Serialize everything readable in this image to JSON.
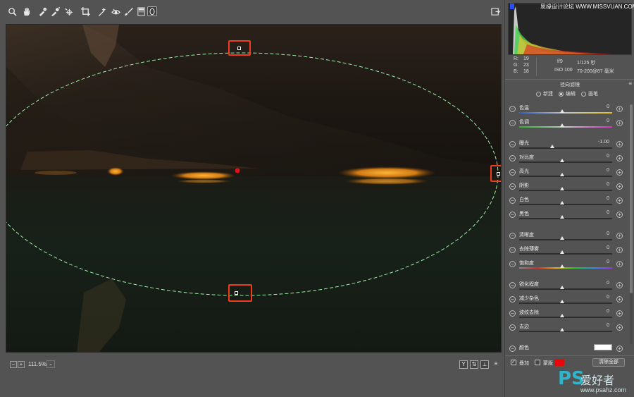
{
  "toolbar": {
    "tools": [
      "zoom-icon",
      "hand-icon",
      "white-balance-icon",
      "color-sampler-icon",
      "target-adjust-icon",
      "crop-icon",
      "spot-removal-icon",
      "red-eye-icon",
      "brush-icon",
      "graduated-filter-icon",
      "radial-filter-icon"
    ],
    "right_icon": "open-preferences-icon"
  },
  "canvas": {
    "zoom": "111.5%",
    "zoom_drop": "⌄",
    "zoom_out": "−",
    "zoom_in": "+",
    "view_buttons": [
      "Y",
      "⇅",
      "⟂",
      "≡"
    ]
  },
  "panel": {
    "watermark_top": "思缘设计论坛 WWW.MISSVUAN.COM",
    "rgb": {
      "r_label": "R:",
      "r": "19",
      "g_label": "G:",
      "g": "23",
      "b_label": "B:",
      "b": "18"
    },
    "camera": {
      "aperture": "f/9",
      "shutter": "1/125 秒",
      "iso": "ISO 100",
      "lens": "70-200@87 毫米"
    },
    "title": "径向滤镜",
    "menu": "≡",
    "modes": [
      {
        "label": "新建",
        "selected": false
      },
      {
        "label": "编辑",
        "selected": true
      },
      {
        "label": "画笔",
        "selected": false
      }
    ],
    "sliders": [
      {
        "label": "色温",
        "value": "0"
      },
      {
        "label": "色调",
        "value": "0"
      },
      {
        "label": "曝光",
        "value": "-1.00"
      },
      {
        "label": "对比度",
        "value": "0"
      },
      {
        "label": "高光",
        "value": "0"
      },
      {
        "label": "阴影",
        "value": "0"
      },
      {
        "label": "白色",
        "value": "0"
      },
      {
        "label": "黑色",
        "value": "0"
      },
      {
        "label": "清晰度",
        "value": "0"
      },
      {
        "label": "去除薄雾",
        "value": "0"
      },
      {
        "label": "饱和度",
        "value": "0"
      },
      {
        "label": "锐化程度",
        "value": "0"
      },
      {
        "label": "减少杂色",
        "value": "0"
      },
      {
        "label": "波纹去除",
        "value": "0"
      },
      {
        "label": "去边",
        "value": "0"
      }
    ],
    "color_label": "颜色",
    "overlay_label": "叠加",
    "overlay_checked": true,
    "mask_label": "蒙版",
    "mask_checked": false,
    "mask_color": "#e8070c",
    "clear_all": "清除全部"
  },
  "watermark": {
    "ps": "PS",
    "cn": "爱好者",
    "url": "www.psahz.com"
  }
}
